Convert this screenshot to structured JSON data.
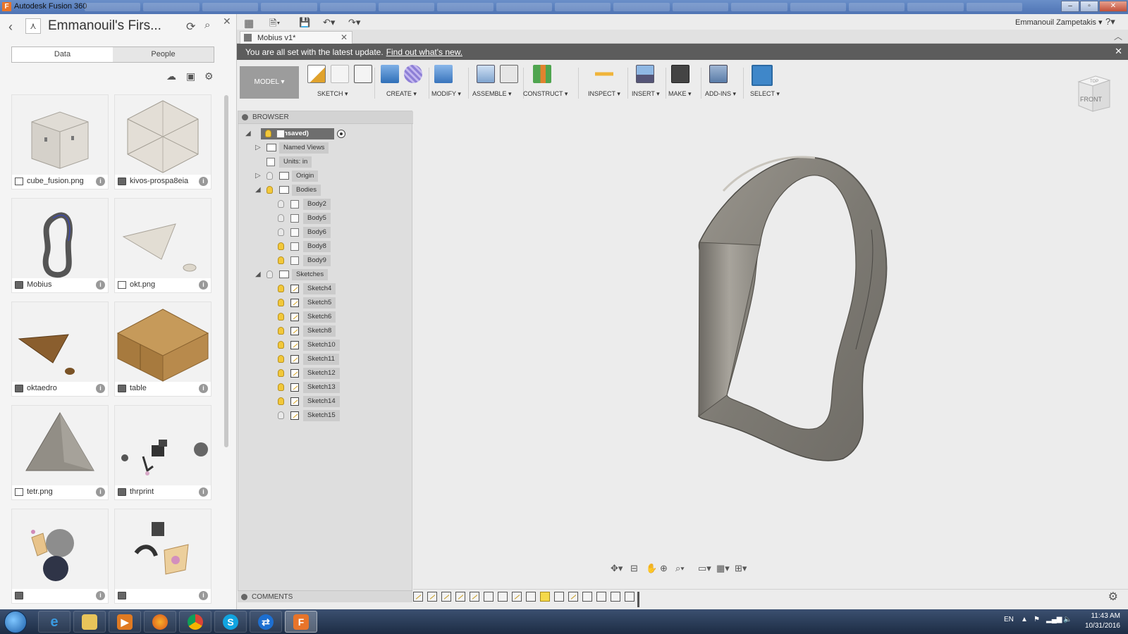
{
  "window": {
    "title": "Autodesk Fusion 360",
    "app_icon": "F"
  },
  "data_panel": {
    "project_title": "Emmanouil's Firs...",
    "tabs": {
      "data": "Data",
      "people": "People"
    },
    "files": [
      {
        "name": "cube_fusion.png",
        "type": "image"
      },
      {
        "name": "kivos-prospa8eia",
        "type": "model"
      },
      {
        "name": "Mobius",
        "type": "model"
      },
      {
        "name": "okt.png",
        "type": "image"
      },
      {
        "name": "oktaedro",
        "type": "model"
      },
      {
        "name": "table",
        "type": "model"
      },
      {
        "name": "tetr.png",
        "type": "image"
      },
      {
        "name": "thrprint",
        "type": "model"
      },
      {
        "name": "",
        "type": "model"
      },
      {
        "name": "",
        "type": "model"
      }
    ]
  },
  "document_tab": {
    "label": "Mobius v1*"
  },
  "user": {
    "name": "Emmanouil Zampetakis ▾"
  },
  "banner": {
    "message": "You are all set with the latest update.",
    "link": "Find out what's new."
  },
  "ribbon": {
    "workspace": "MODEL ▾",
    "groups": [
      {
        "label": "SKETCH ▾"
      },
      {
        "label": "CREATE ▾"
      },
      {
        "label": "MODIFY ▾"
      },
      {
        "label": "ASSEMBLE ▾"
      },
      {
        "label": "CONSTRUCT ▾"
      },
      {
        "label": "INSPECT ▾"
      },
      {
        "label": "INSERT ▾"
      },
      {
        "label": "MAKE ▾"
      },
      {
        "label": "ADD-INS ▾"
      },
      {
        "label": "SELECT ▾"
      }
    ]
  },
  "viewcube": {
    "top": "TOP",
    "front": "FRONT"
  },
  "browser": {
    "title": "BROWSER",
    "root": "(Unsaved)",
    "named_views": "Named Views",
    "units": "Units: in",
    "origin": "Origin",
    "bodies_folder": "Bodies",
    "bodies": [
      "Body2",
      "Body5",
      "Body6",
      "Body8",
      "Body9"
    ],
    "sketches_folder": "Sketches",
    "sketches": [
      "Sketch4",
      "Sketch5",
      "Sketch6",
      "Sketch8",
      "Sketch10",
      "Sketch11",
      "Sketch12",
      "Sketch13",
      "Sketch14",
      "Sketch15"
    ]
  },
  "comments": {
    "title": "COMMENTS"
  },
  "taskbar": {
    "lang": "EN",
    "time": "11:43 AM",
    "date": "10/31/2016"
  }
}
